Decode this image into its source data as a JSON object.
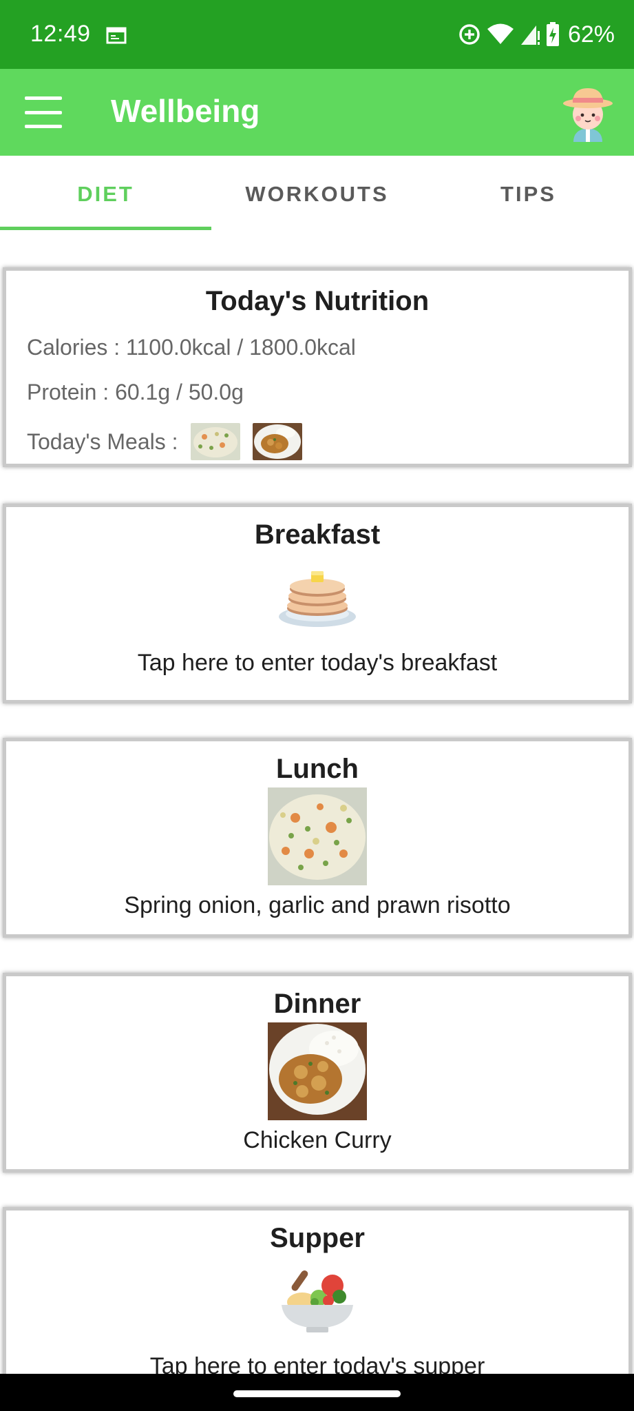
{
  "status_bar": {
    "time": "12:49",
    "battery": "62%",
    "icons": [
      "calendar-icon",
      "data-saver-icon",
      "wifi-icon",
      "signal-icon",
      "battery-charging-icon"
    ],
    "background": "#24a123"
  },
  "app_bar": {
    "title": "Wellbeing",
    "icons": [
      "menu-icon",
      "avatar-icon"
    ],
    "background": "#5fd95d"
  },
  "tabs": [
    {
      "label": "DIET",
      "active": true
    },
    {
      "label": "WORKOUTS",
      "active": false
    },
    {
      "label": "TIPS",
      "active": false
    }
  ],
  "accent_color": "#5fcf5d",
  "nutrition": {
    "title": "Today's Nutrition",
    "calories": "Calories : 1100.0kcal / 1800.0kcal",
    "protein": "Protein : 60.1g / 50.0g",
    "meals_label": "Today's Meals :",
    "meal_images": [
      "risotto-image",
      "chicken-curry-image"
    ]
  },
  "meals": {
    "breakfast": {
      "title": "Breakfast",
      "icon": "pancakes-icon",
      "caption": "Tap here to enter today's breakfast"
    },
    "lunch": {
      "title": "Lunch",
      "image": "risotto-image",
      "caption": "Spring onion, garlic and prawn risotto"
    },
    "dinner": {
      "title": "Dinner",
      "image": "chicken-curry-image",
      "caption": "Chicken Curry"
    },
    "supper": {
      "title": "Supper",
      "icon": "salad-bowl-icon",
      "caption": "Tap here to enter today's supper"
    }
  }
}
